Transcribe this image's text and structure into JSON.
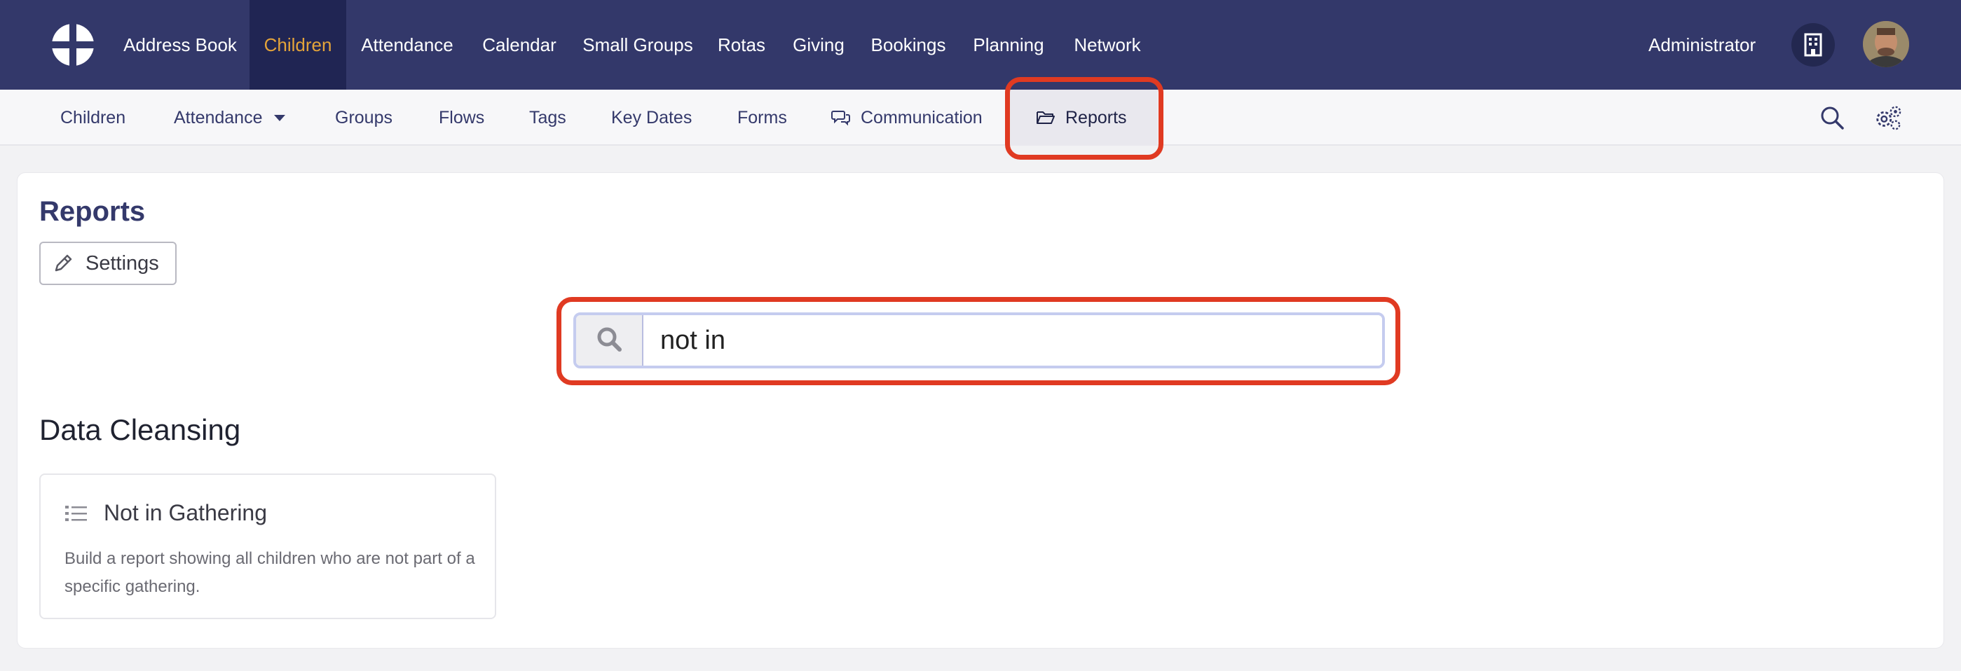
{
  "topnav": {
    "items": [
      {
        "label": "Address Book"
      },
      {
        "label": "Children"
      },
      {
        "label": "Attendance"
      },
      {
        "label": "Calendar"
      },
      {
        "label": "Small Groups"
      },
      {
        "label": "Rotas"
      },
      {
        "label": "Giving"
      },
      {
        "label": "Bookings"
      },
      {
        "label": "Planning"
      },
      {
        "label": "Network"
      }
    ],
    "active_item": "Children",
    "user_label": "Administrator"
  },
  "subnav": {
    "items": [
      {
        "label": "Children"
      },
      {
        "label": "Attendance"
      },
      {
        "label": "Groups"
      },
      {
        "label": "Flows"
      },
      {
        "label": "Tags"
      },
      {
        "label": "Key Dates"
      },
      {
        "label": "Forms"
      },
      {
        "label": "Communication"
      },
      {
        "label": "Reports"
      }
    ],
    "active_item": "Reports"
  },
  "main": {
    "title": "Reports",
    "settings_label": "Settings",
    "search": {
      "value": "not in"
    },
    "section_title": "Data Cleansing",
    "report_card": {
      "title": "Not in Gathering",
      "description": "Build a report showing all children who are not part of a specific gathering."
    }
  },
  "colors": {
    "topbar_bg": "#33386a",
    "active_nav_text": "#e4a43a",
    "highlight_outline": "#e03a22",
    "title_text": "#34396b"
  },
  "icons": {
    "logo": "cross-circle-logo",
    "building": "building-icon",
    "search": "search-icon",
    "settings_cog": "cogs-icon",
    "pencil": "pencil-icon",
    "comments": "comments-icon",
    "folder": "folder-open-icon",
    "list": "list-icon"
  }
}
